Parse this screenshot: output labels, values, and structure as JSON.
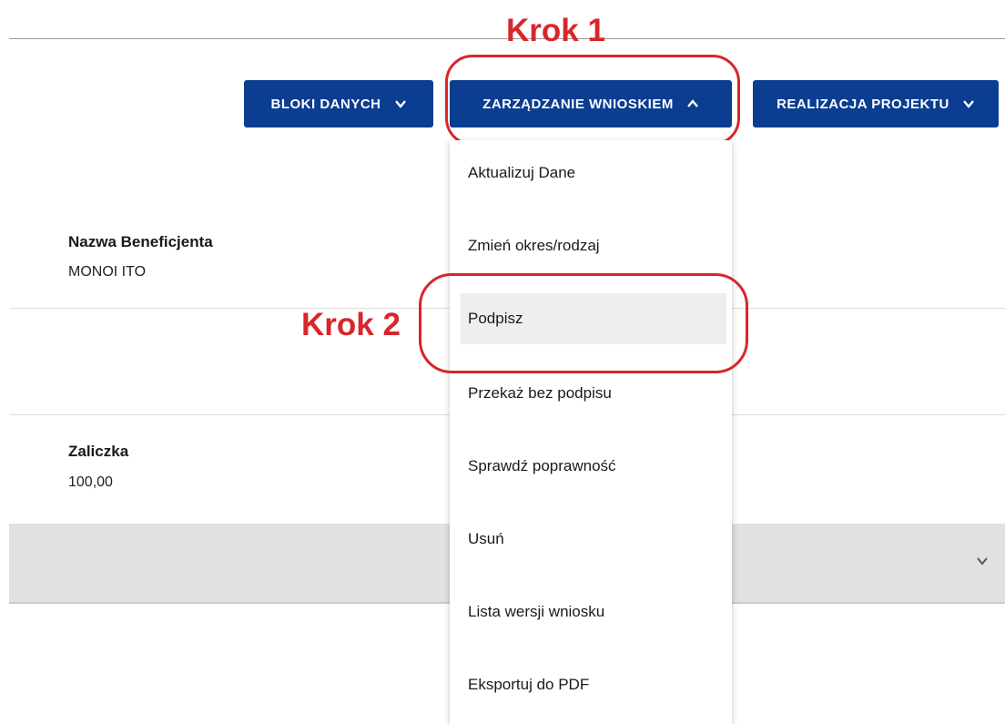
{
  "annotations": {
    "step1": "Krok 1",
    "step2": "Krok 2"
  },
  "nav": {
    "bloki_label": "BLOKI DANYCH",
    "zarzadzanie_label": "ZARZĄDZANIE WNIOSKIEM",
    "realizacja_label": "REALIZACJA PROJEKTU"
  },
  "dropdown": {
    "items": [
      {
        "label": "Aktualizuj Dane"
      },
      {
        "label": "Zmień okres/rodzaj"
      },
      {
        "label": "Podpisz"
      },
      {
        "label": "Przekaż bez podpisu"
      },
      {
        "label": "Sprawdź poprawność"
      },
      {
        "label": "Usuń"
      },
      {
        "label": "Lista wersji wniosku"
      },
      {
        "label": "Eksportuj do PDF"
      }
    ]
  },
  "fields": {
    "beneficjent": {
      "label": "Nazwa Beneficjenta",
      "value": "MONOI ITO"
    },
    "zaliczka": {
      "label": "Zaliczka",
      "value": "100,00"
    }
  },
  "colors": {
    "accent": "#0b3d91",
    "annotation": "#d8262b"
  }
}
